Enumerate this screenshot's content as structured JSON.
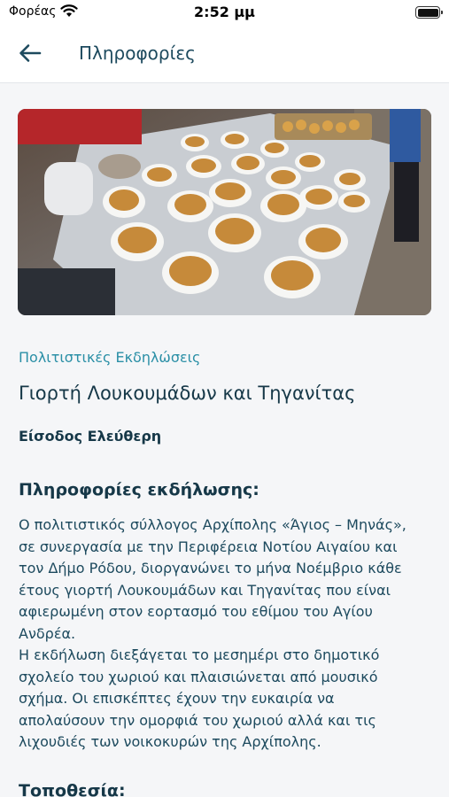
{
  "status_bar": {
    "carrier": "Φορέας",
    "time": "2:52 μμ"
  },
  "nav": {
    "title": "Πληροφορίες",
    "back_icon": "arrow-left-icon"
  },
  "event": {
    "category": "Πολιτιστικές Εκδηλώσεις",
    "title": "Γιορτή Λουκουμάδων και Τηγανίτας",
    "entrance": "Είσοδος Ελεύθερη",
    "info_heading": "Πληροφορίες εκδήλωσης:",
    "description_lines": [
      "Ο πολιτιστικός σύλλογος Αρχίπολης «Άγιος – Μηνάς»,",
      "σε συνεργασία με την Περιφέρεια Νοτίου Αιγαίου και",
      "τον Δήμο Ρόδου, διοργανώνει το μήνα Νοέμβριο κάθε",
      "έτους γιορτή Λουκουμάδων και Τηγανίτας που είναι",
      "αφιερωμένη στον εορτασμό του εθίμου του Αγίου",
      "Ανδρέα.",
      "Η εκδήλωση διεξάγεται το μεσημέρι στο δημοτικό",
      "σχολείο του χωριού και πλαισιώνεται από μουσικό",
      "σχήμα. Οι επισκέπτες έχουν την ευκαιρία να",
      "απολαύσουν την ομορφιά του χωριού αλλά και τις",
      "λιχουδιές των νοικοκυρών της Αρχίπολης."
    ],
    "location_heading": "Τοποθεσία:"
  },
  "colors": {
    "accent": "#2a8fa6",
    "text_dark": "#163848",
    "background": "#f5f6f8"
  }
}
